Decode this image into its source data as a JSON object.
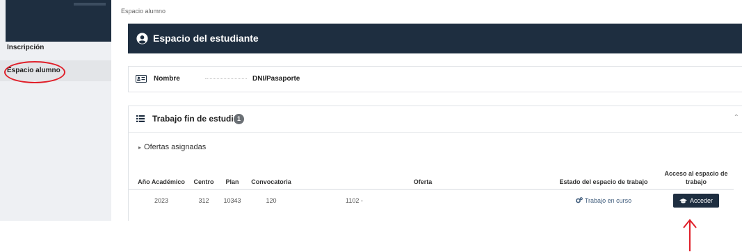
{
  "sidebar": {
    "items": [
      {
        "label": "Inscripción"
      },
      {
        "label": "Espacio alumno",
        "active": true
      }
    ]
  },
  "breadcrumb": "Espacio alumno",
  "header": {
    "title": "Espacio del estudiante",
    "icon": "user-circle-icon"
  },
  "student": {
    "name_label": "Nombre",
    "id_label": "DNI/Pasaporte"
  },
  "tfe": {
    "title": "Trabajo fin de estudios",
    "count": "1",
    "subsection": "Ofertas asignadas",
    "columns": [
      "Año Académico",
      "Centro",
      "Plan",
      "Convocatoria",
      "Oferta",
      "Estado del espacio de trabajo",
      "Acceso al espacio de trabajo"
    ],
    "rows": [
      {
        "anio": "2023",
        "centro": "312",
        "plan": "10343",
        "convocatoria": "120",
        "oferta": "1102 -",
        "estado": "Trabajo en curso",
        "accion": "Acceder"
      }
    ]
  },
  "colors": {
    "navy": "#1e2e40",
    "annotation": "#e0202a"
  }
}
